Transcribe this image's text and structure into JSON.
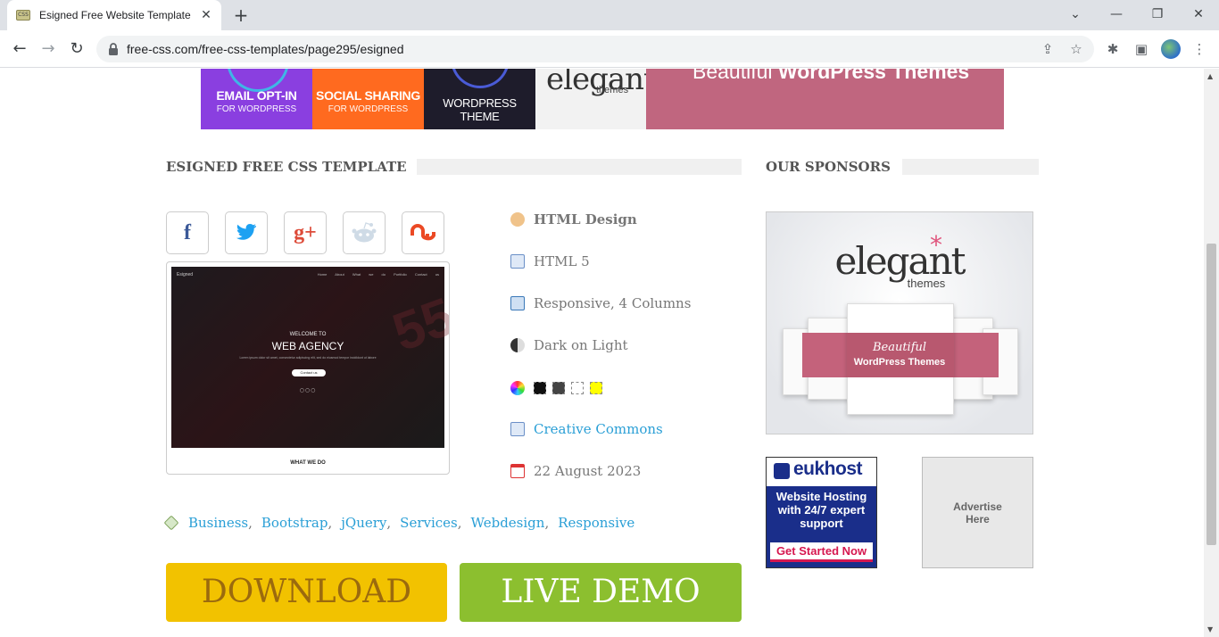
{
  "browser": {
    "tab_title": "Esigned Free Website Template |",
    "tab_favicon_text": "CSS",
    "url": "free-css.com/free-css-templates/page295/esigned",
    "icons": [
      "back-icon",
      "forward-icon",
      "reload-icon",
      "lock-icon",
      "share-icon",
      "bookmark-star-icon",
      "extensions-icon",
      "side-panel-icon",
      "profile-avatar",
      "more-menu-icon"
    ]
  },
  "banner": {
    "opt_in_main": "EMAIL OPT-IN",
    "opt_in_sub": "FOR WORDPRESS",
    "social_main": "SOCIAL SHARING",
    "social_sub": "FOR WORDPRESS",
    "theme_main": "WORDPRESS THEME",
    "elegant": "elegant",
    "themes": "themes",
    "wp_prefix": "Beautiful ",
    "wp_bold": "WordPress Themes"
  },
  "main": {
    "section_title": "ESIGNED FREE CSS TEMPLATE",
    "share_buttons": [
      {
        "name": "facebook",
        "glyph": "f",
        "color": "#3b5998"
      },
      {
        "name": "twitter",
        "glyph": "t",
        "color": "#1da1f2"
      },
      {
        "name": "google-plus",
        "glyph": "g+",
        "color": "#dd4b39"
      },
      {
        "name": "reddit",
        "glyph": "r",
        "color": "#8aa5b8"
      },
      {
        "name": "stumbleupon",
        "glyph": "su",
        "color": "#eb4924"
      }
    ],
    "preview": {
      "brand": "Esigned",
      "menu": "Home About What we do Portfolio Contact us",
      "welcome": "WELCOME TO",
      "headline": "WEB AGENCY",
      "lorem": "Lorem ipsum dolor sit amet, consectetur adipiscing elit, sed do eiusmod tempor incididunt ut labore",
      "button": "Contact us",
      "what_we_do": "WHAT WE DO"
    },
    "attributes": {
      "design": "HTML Design",
      "html": "HTML 5",
      "layout": "Responsive, 4 Columns",
      "theme": "Dark on Light",
      "license": "Creative Commons",
      "date": "22 August 2023"
    },
    "colors": [
      "#111111",
      "#444444",
      "#ffffff",
      "#ffff00"
    ],
    "tags": [
      "Business",
      "Bootstrap",
      "jQuery",
      "Services",
      "Webdesign",
      "Responsive"
    ],
    "tag_separator": ",",
    "download_label": "DOWNLOAD",
    "demo_label": "LIVE DEMO"
  },
  "sidebar": {
    "title": "OUR SPONSORS",
    "elegant_ad": {
      "brand": "elegant",
      "star": "*",
      "sub": "themes",
      "ribbon_line1": "Beautiful",
      "ribbon_line2": "WordPress Themes"
    },
    "eukhost_ad": {
      "brand": "eukhost",
      "line1": "Website Hosting",
      "line2": "with 24/7 expert",
      "line3": "support",
      "cta": "Get Started Now"
    },
    "advertise_line1": "Advertise",
    "advertise_line2": "Here"
  }
}
